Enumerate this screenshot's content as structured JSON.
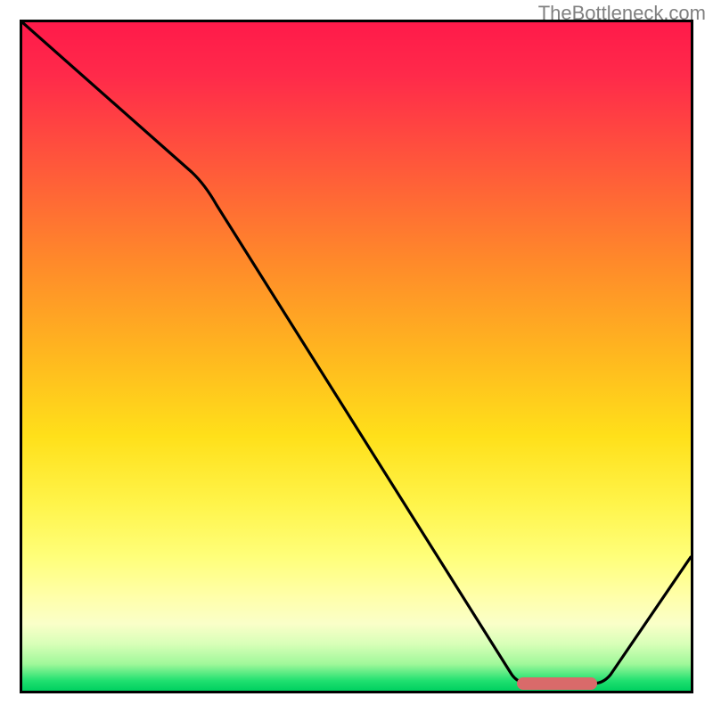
{
  "watermark": "TheBottleneck.com",
  "chart_data": {
    "type": "line",
    "title": "",
    "xlabel": "",
    "ylabel": "",
    "xlim": [
      0,
      100
    ],
    "ylim": [
      0,
      100
    ],
    "x": [
      0,
      25,
      75,
      85,
      100
    ],
    "y": [
      100,
      78,
      1,
      1,
      20
    ],
    "optimal_range": {
      "start_x": 74,
      "end_x": 86
    },
    "gradient_stops": [
      {
        "pos": 0,
        "color": "#ff1a4a"
      },
      {
        "pos": 50,
        "color": "#ffe01a"
      },
      {
        "pos": 80,
        "color": "#ffff7a"
      },
      {
        "pos": 100,
        "color": "#00d060"
      }
    ]
  }
}
